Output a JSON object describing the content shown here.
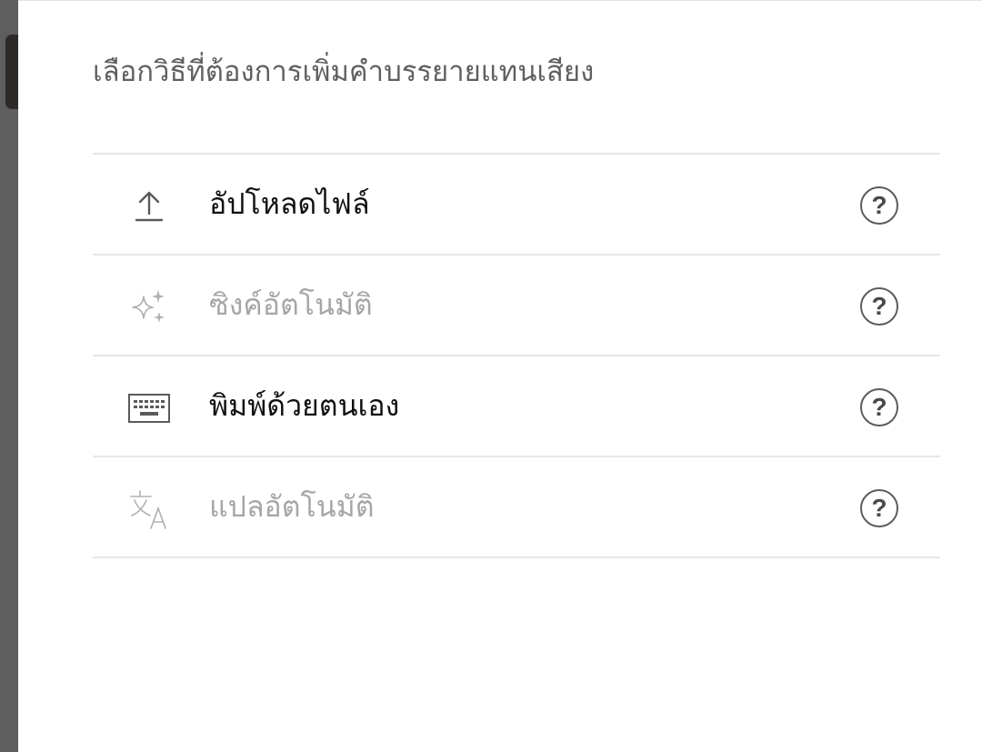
{
  "heading": "เลือกวิธีที่ต้องการเพิ่มคำบรรยายแทนเสียง",
  "options": [
    {
      "label": "อัปโหลดไฟล์",
      "icon": "upload-icon",
      "enabled": true
    },
    {
      "label": "ซิงค์อัตโนมัติ",
      "icon": "sparkle-icon",
      "enabled": false
    },
    {
      "label": "พิมพ์ด้วยตนเอง",
      "icon": "keyboard-icon",
      "enabled": true
    },
    {
      "label": "แปลอัตโนมัติ",
      "icon": "translate-icon",
      "enabled": false
    }
  ],
  "help_glyph": "?",
  "colors": {
    "enabled_text": "#111111",
    "disabled_text": "#a6a6a6",
    "divider": "#e6e6e6",
    "backdrop": "#5e5e5e"
  }
}
